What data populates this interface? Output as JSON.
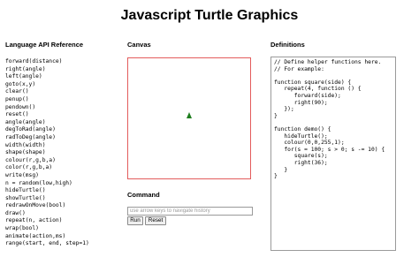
{
  "page": {
    "title": "Javascript Turtle Graphics"
  },
  "sections": {
    "api_heading": "Language API Reference",
    "canvas_heading": "Canvas",
    "definitions_heading": "Definitions",
    "command_heading": "Command"
  },
  "api_items": [
    "forward(distance)",
    "right(angle)",
    "left(angle)",
    "goto(x,y)",
    "clear()",
    "penup()",
    "pendown()",
    "reset()",
    "angle(angle)",
    "degToRad(angle)",
    "radToDeg(angle)",
    "width(width)",
    "shape(shape)",
    "colour(r,g,b,a)",
    "color(r,g,b,a)",
    "write(msg)",
    "n = random(low,high)",
    "hideTurtle()",
    "showTurtle()",
    "redrawOnMove(bool)",
    "draw()",
    "repeat(n, action)",
    "wrap(bool)",
    "animate(action,ms)",
    "range(start, end, step=1)"
  ],
  "command": {
    "placeholder": "use arrow keys to navigate history",
    "value": "",
    "run_label": "Run",
    "reset_label": "Reset"
  },
  "definitions": {
    "code": "// Define helper functions here.\n// For example:\n\nfunction square(side) {\n   repeat(4, function () {\n      forward(side);\n      right(90);\n   });\n}\n\nfunction demo() {\n   hideTurtle();\n   colour(0,0,255,1);\n   for(s = 100; s > 0; s -= 10) {\n      square(s);\n      right(36);\n   }\n}"
  },
  "colors": {
    "canvas_border": "#e35c5c",
    "turtle": "#1e7d1e"
  },
  "icons": {
    "turtle": "turtle-arrow-icon"
  }
}
